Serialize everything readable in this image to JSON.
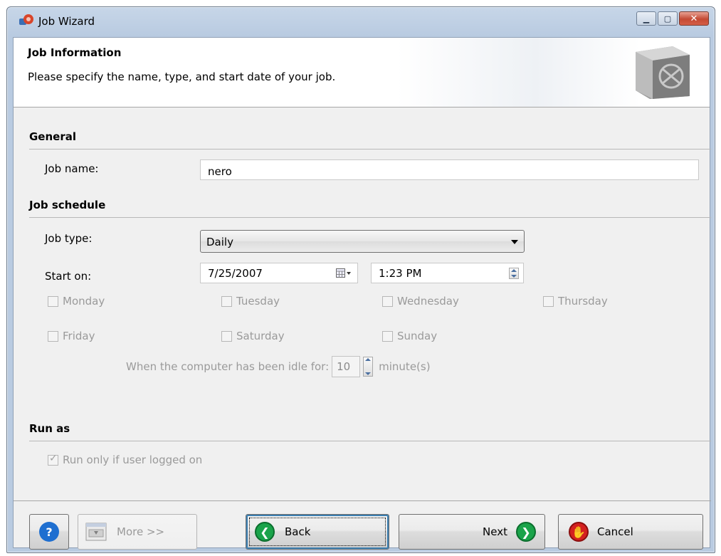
{
  "window": {
    "title": "Job Wizard"
  },
  "header": {
    "title": "Job Information",
    "subtitle": "Please specify the name, type, and start date of your job."
  },
  "general": {
    "section_title": "General",
    "job_name_label": "Job name:",
    "job_name_value": "nero"
  },
  "schedule": {
    "section_title": "Job schedule",
    "job_type_label": "Job type:",
    "job_type_value": "Daily",
    "start_on_label": "Start on:",
    "start_date": "7/25/2007",
    "start_time": "1:23 PM",
    "days": [
      "Monday",
      "Tuesday",
      "Wednesday",
      "Thursday",
      "Friday",
      "Saturday",
      "Sunday"
    ],
    "idle_label": "When the computer has been idle for:",
    "idle_value": "10",
    "idle_unit": "minute(s)"
  },
  "run_as": {
    "section_title": "Run as",
    "run_only_label": "Run only if user logged on",
    "run_only_checked": true
  },
  "buttons": {
    "more": "More >>",
    "back": "Back",
    "next": "Next",
    "cancel": "Cancel"
  },
  "colors": {
    "help_blue": "#1f6fd0",
    "nav_green": "#1aa34a",
    "cancel_red": "#d42020"
  },
  "icons": [
    "app-icon",
    "safe-icon",
    "calendar-icon",
    "help-icon",
    "more-icon",
    "back-arrow-icon",
    "next-arrow-icon",
    "stop-hand-icon"
  ]
}
